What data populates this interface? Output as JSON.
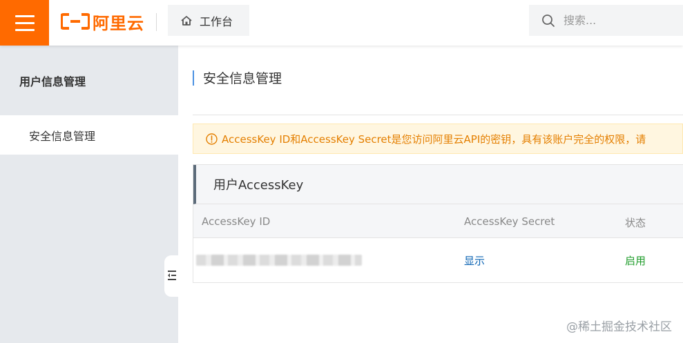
{
  "header": {
    "logo_text": "阿里云",
    "brand_color": "#ff6a00",
    "workbench_label": "工作台",
    "search_placeholder": "搜索..."
  },
  "sidebar": {
    "title": "用户信息管理",
    "items": [
      {
        "label": "安全信息管理",
        "active": true
      }
    ]
  },
  "main": {
    "page_title": "安全信息管理",
    "notice": "AccessKey ID和AccessKey Secret是您访问阿里云API的密钥，具有该账户完全的权限，请",
    "panel": {
      "title": "用户AccessKey",
      "columns": [
        "AccessKey ID",
        "AccessKey Secret",
        "状态"
      ],
      "rows": [
        {
          "access_key_id": "",
          "secret_action": "显示",
          "status": "启用"
        }
      ]
    }
  },
  "watermark": "@稀土掘金技术社区",
  "icons": {
    "menu": "hamburger-menu-icon",
    "home": "home-icon",
    "search": "search-icon",
    "notice": "warning-circle-icon",
    "collapse": "collapse-sidebar-icon"
  }
}
